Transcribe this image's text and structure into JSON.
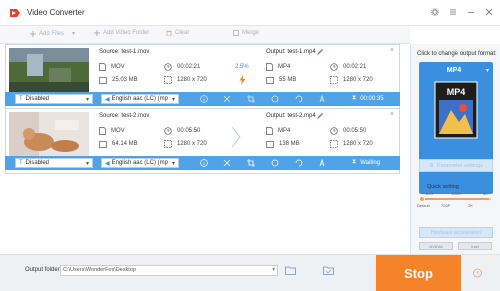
{
  "window": {
    "title": "Video Converter",
    "icons": [
      "app-logo",
      "settings-icon",
      "list-icon",
      "minimize-icon",
      "close-icon"
    ]
  },
  "toolbar": {
    "add_files": "Add Files",
    "add_video_folder": "Add Video Folder",
    "clear": "Clear",
    "merge": "Merge"
  },
  "tasks": [
    {
      "source": "Source: test-1.mov",
      "src_format": "MOV",
      "src_duration": "00:02:21",
      "src_size": "25.03 MB",
      "src_resolution": "1280 x 720",
      "progress_text": "2.5%",
      "output": "Output: test-1.mp4",
      "out_format": "MP4",
      "out_duration": "00:02:21",
      "out_size": "55 MB",
      "out_resolution": "1280 x 720",
      "subtitle": "Disabled",
      "audio": "English aac (LC) (mp",
      "status": "00:00:35"
    },
    {
      "source": "Source: test-2.mov",
      "src_format": "MOV",
      "src_duration": "00:05:50",
      "src_size": "64.14 MB",
      "src_resolution": "1280 x 720",
      "progress_text": "",
      "output": "Output: test-2.mp4",
      "out_format": "MP4",
      "out_duration": "00:05:50",
      "out_size": "138 MB",
      "out_resolution": "1280 x 720",
      "subtitle": "Disabled",
      "audio": "English aac (LC) (mp",
      "status": "Waiting"
    }
  ],
  "bottom": {
    "output_folder_label": "Output folder:",
    "output_folder_path": "C:\\Users\\WonderFox\\Desktop",
    "stop_label": "Stop"
  },
  "sidebar": {
    "title": "Click to change output format:",
    "format": "MP4",
    "parameter_settings": "Parameter settings",
    "quick_setting": "Quick setting",
    "ticks_top": [
      "480P",
      "1080P",
      "4K"
    ],
    "ticks_bottom": [
      "Default",
      "720P",
      "2K"
    ],
    "hardware_accel": "Hardware acceleration",
    "gpu1": "NVIDIA",
    "gpu2": "Intel"
  },
  "colors": {
    "accent": "#4fa3e6",
    "stop": "#f58329",
    "format_box": "#3b8fe0"
  }
}
